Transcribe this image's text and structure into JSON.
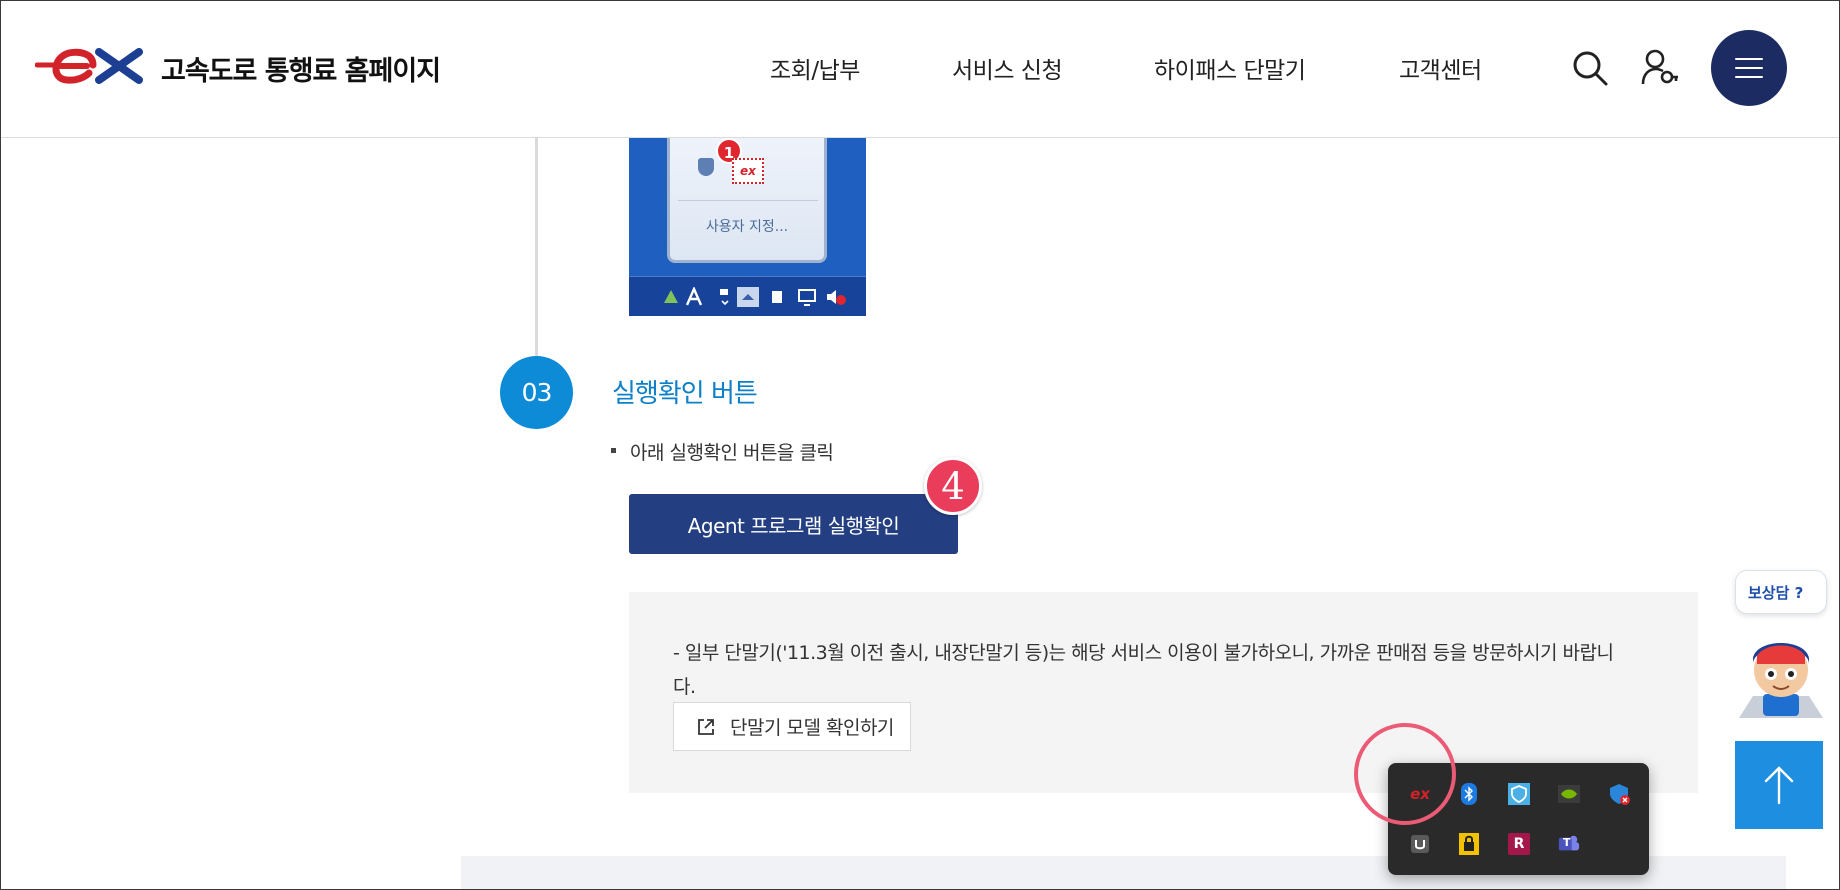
{
  "header": {
    "site_title": "고속도로 통행료 홈페이지",
    "nav": [
      "조회/납부",
      "서비스 신청",
      "하이패스 단말기",
      "고객센터"
    ],
    "logo_text": "ex"
  },
  "screenshot": {
    "badge": "1",
    "ex_label": "ex",
    "custom_label": "사용자 지정..."
  },
  "step": {
    "number": "03",
    "title": "실행확인 버튼",
    "bullet": "아래 실행확인 버튼을 클릭",
    "agent_button": "Agent 프로그램 실행확인",
    "marker": "4"
  },
  "notice": {
    "text": "- 일부 단말기('11.3월 이전 출시, 내장단말기 등)는 해당 서비스 이용이 불가하오니, 가까운 판매점 등을 방문하시기 바랍니다.",
    "model_button": "단말기 모델 확인하기"
  },
  "floating": {
    "chat_label": "보상담 ?"
  },
  "tray": {
    "icons": [
      "ex-icon",
      "bluetooth-icon",
      "shield-icon",
      "nvidia-icon",
      "defender-icon",
      "usb-icon",
      "lock-icon",
      "r-icon",
      "teams-icon"
    ],
    "ex_label": "ex",
    "r_label": "R",
    "teams_label": "T"
  },
  "colors": {
    "navy": "#1c2c63",
    "accent_blue": "#0e8bd6",
    "button_navy": "#233f82",
    "highlight_pink": "#ec5b75",
    "brand_red": "#d2232a"
  }
}
